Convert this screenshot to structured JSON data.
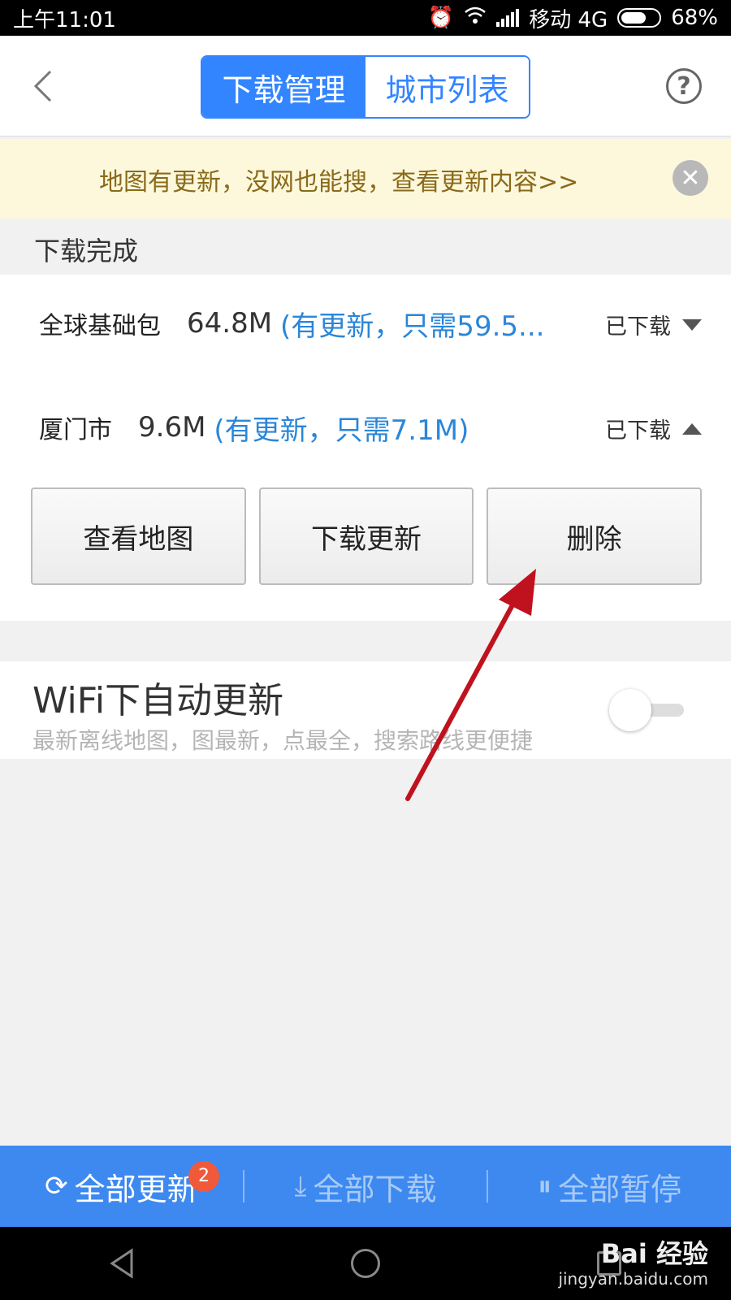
{
  "status_bar": {
    "time": "上午11:01",
    "carrier": "移动 4G",
    "battery": "68%",
    "battery_level": 0.68
  },
  "header": {
    "tabs": [
      {
        "label": "下载管理",
        "active": true
      },
      {
        "label": "城市列表",
        "active": false
      }
    ],
    "help_label": "?"
  },
  "notice": {
    "text": "地图有更新，没网也能搜，查看更新内容>>",
    "close_label": "✕"
  },
  "section": {
    "title": "下载完成"
  },
  "downloads": [
    {
      "name": "全球基础包",
      "size": "64.8M",
      "update": "(有更新，只需59.5...",
      "status": "已下载",
      "expanded": false
    },
    {
      "name": "厦门市",
      "size": "9.6M",
      "update": "(有更新，只需7.1M)",
      "status": "已下载",
      "expanded": true
    }
  ],
  "actions": {
    "view_map": "查看地图",
    "download_update": "下载更新",
    "delete": "删除"
  },
  "wifi": {
    "title": "WiFi下自动更新",
    "desc": "最新离线地图，图最新，点最全，搜索路线更便捷",
    "enabled": false
  },
  "bottom_bar": {
    "update_all": "全部更新",
    "update_badge": "2",
    "download_all": "全部下载",
    "pause_all": "全部暂停"
  },
  "watermark": {
    "logo": "Bai 经验",
    "url": "jingyan.baidu.com"
  },
  "colors": {
    "accent": "#3385ff",
    "bottom_bar": "#3d89f0",
    "link": "#2a86d8",
    "notice_bg": "#fdf8dc",
    "arrow": "#c0121e"
  }
}
